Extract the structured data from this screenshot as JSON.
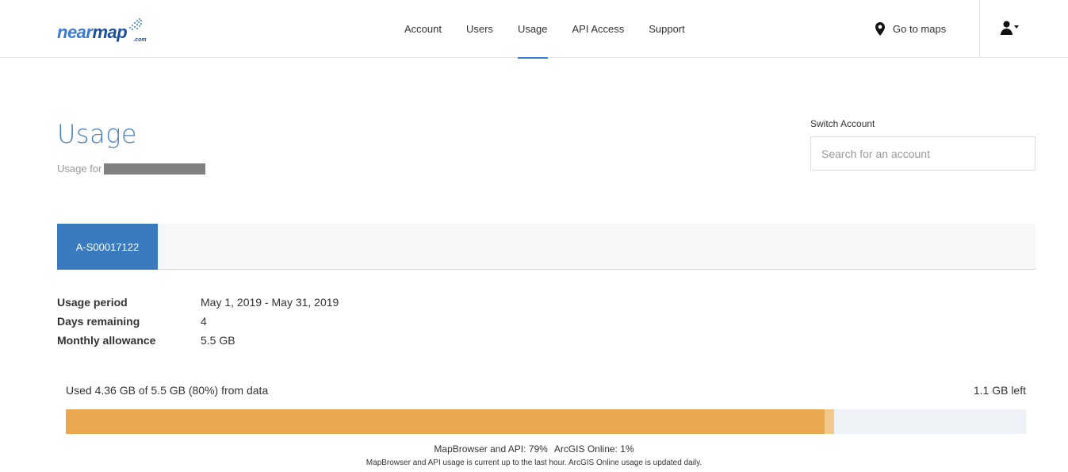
{
  "brand": {
    "logo_primary": "near",
    "logo_secondary": "map",
    "logo_suffix": ".com",
    "color": "#3a7bd5"
  },
  "nav": {
    "items": [
      {
        "label": "Account",
        "active": false
      },
      {
        "label": "Users",
        "active": false
      },
      {
        "label": "Usage",
        "active": true
      },
      {
        "label": "API Access",
        "active": false
      },
      {
        "label": "Support",
        "active": false
      }
    ],
    "goto_maps": "Go to maps",
    "goto_icon": "map-pin-icon",
    "user_icon": "user-icon"
  },
  "page": {
    "title": "Usage",
    "usage_for_label": "Usage for"
  },
  "switch_account": {
    "label": "Switch Account",
    "placeholder": "Search for an account",
    "value": ""
  },
  "tabs": [
    {
      "label": "A-S00017122",
      "active": true
    }
  ],
  "details": [
    {
      "label": "Usage period",
      "value": "May 1, 2019 - May 31, 2019"
    },
    {
      "label": "Days remaining",
      "value": "4"
    },
    {
      "label": "Monthly allowance",
      "value": "5.5 GB"
    }
  ],
  "usage": {
    "used_text": "Used 4.36 GB of 5.5 GB (80%) from data",
    "left_text": "1.1 GB left",
    "segments": [
      {
        "name": "MapBrowser and API",
        "percent": 79,
        "color": "#e9a84f"
      },
      {
        "name": "ArcGIS Online",
        "percent": 1,
        "color": "#f3c98a"
      }
    ],
    "legend_1": "MapBrowser and API: 79%",
    "legend_2": "ArcGIS Online: 1%",
    "note": "MapBrowser and API usage is current up to the last hour. ArcGIS Online usage is updated daily."
  }
}
